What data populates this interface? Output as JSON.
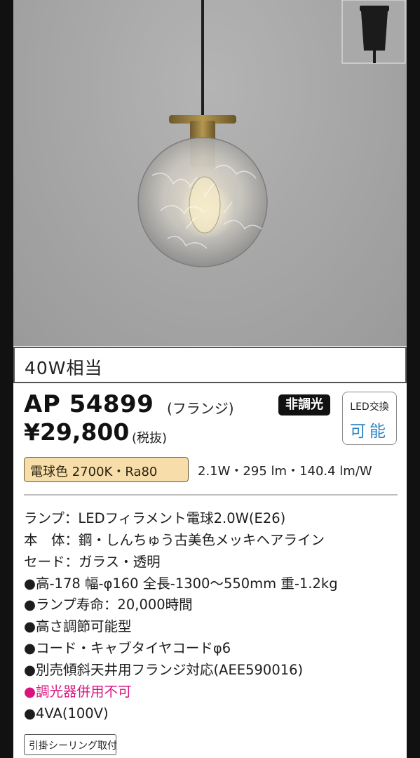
{
  "wattage_equivalent": "40W相当",
  "product": {
    "model": "AP 54899",
    "model_note": "(フランジ)",
    "price": "¥29,800",
    "price_note": "(税抜)"
  },
  "badges": {
    "dimming": "非調光",
    "led_line1": "LED交換",
    "led_line2": "可能",
    "color": "電球色 2700K・Ra80"
  },
  "efficiency": "2.1W・295 lm・140.4 lm/W",
  "specs": [
    {
      "text": "ランプ：LEDフィラメント電球2.0W(E26)"
    },
    {
      "text": "本　体：鋼・しんちゅう古美色メッキヘアライン"
    },
    {
      "text": "セード：ガラス・透明"
    },
    {
      "text": "●高-178 幅-φ160 全長-1300〜550mm 重-1.2kg"
    },
    {
      "text": "●ランプ寿命：20,000時間"
    },
    {
      "text": "●高さ調節可能型"
    },
    {
      "text": "●コード・キャブタイヤコードφ6"
    },
    {
      "text": "●別売傾斜天井用フランジ対応(AEE590016)"
    },
    {
      "text": "●調光器併用不可"
    },
    {
      "text": "●4VA(100V)"
    }
  ],
  "mount_tag": "引掛シーリング取付",
  "colors": {
    "dimmer_warning": "#d9147f",
    "led_accent": "#2a84c4",
    "color_badge_bg": "#f7ddaa"
  }
}
